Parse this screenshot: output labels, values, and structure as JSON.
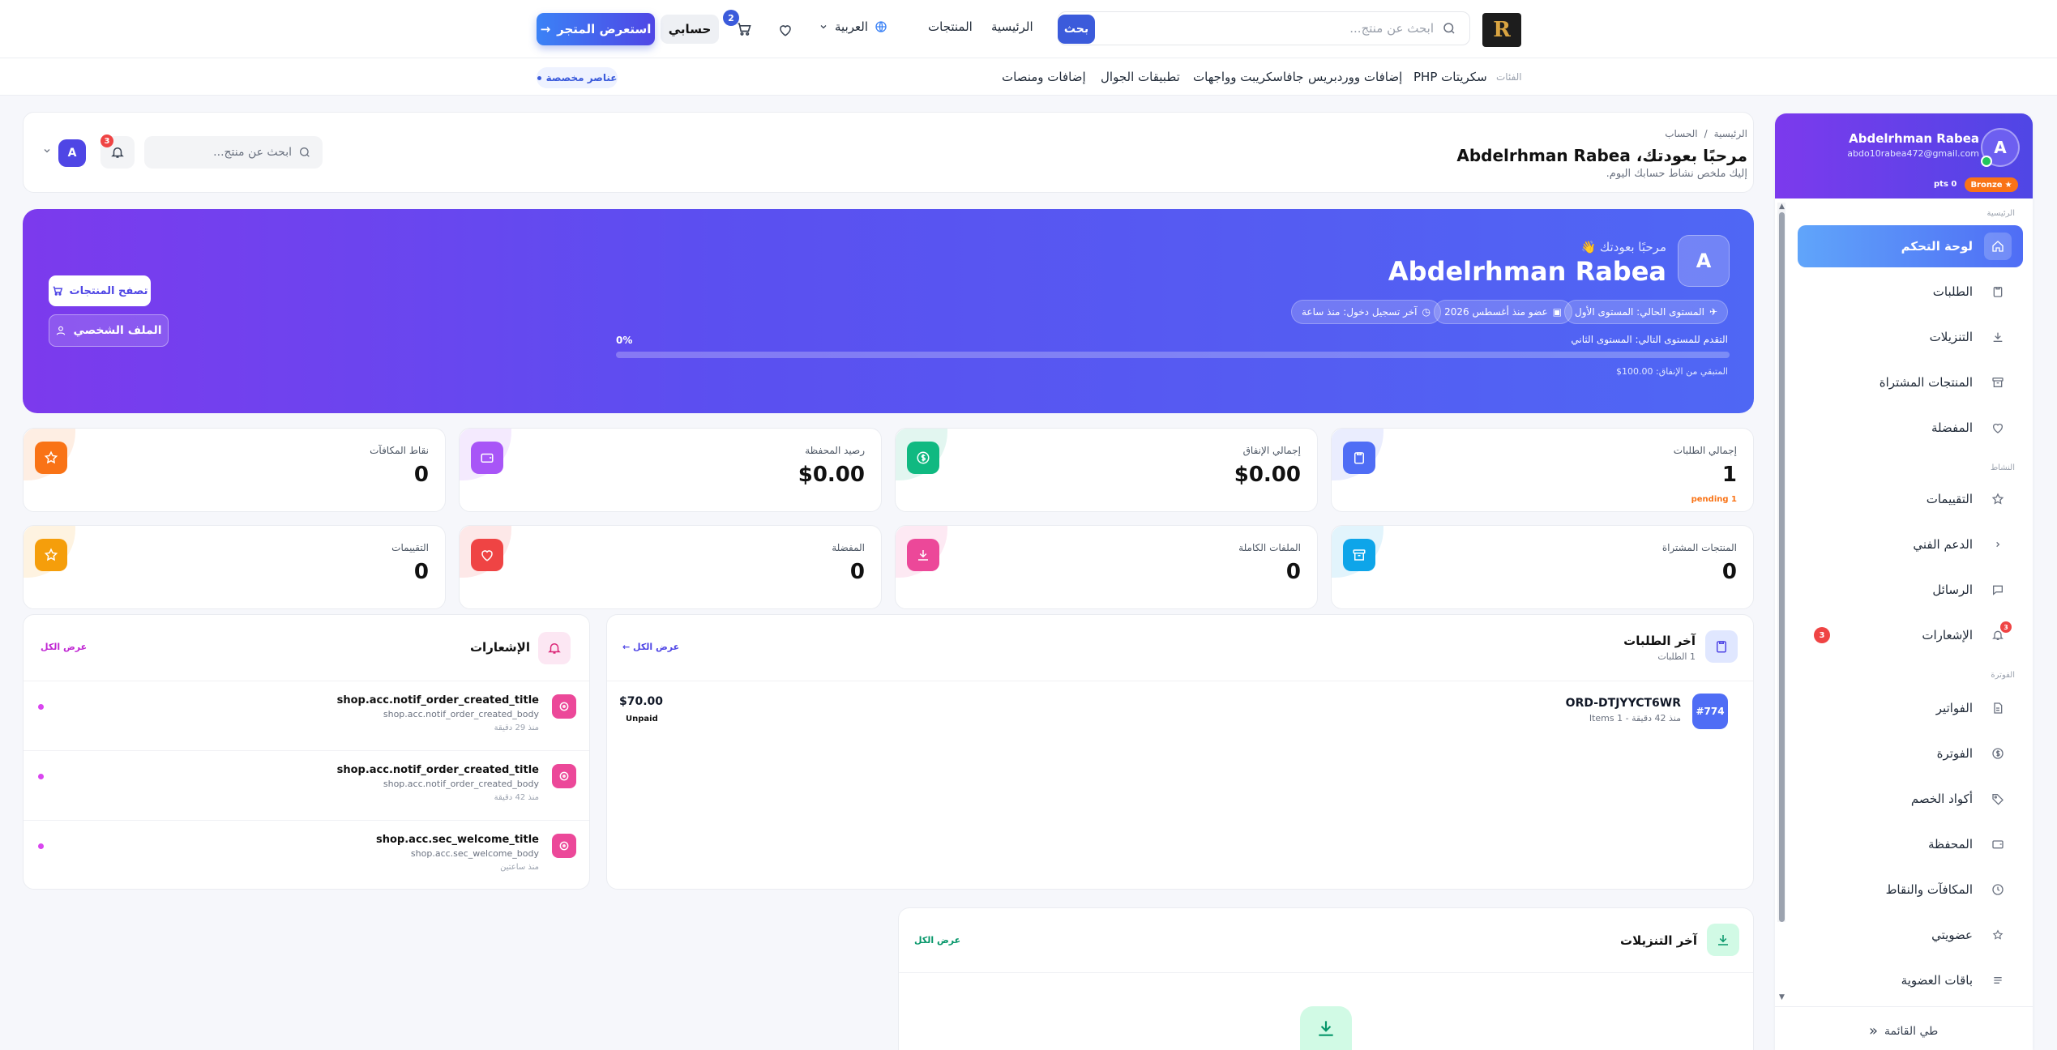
{
  "topbar": {
    "logo_text": "R",
    "search_placeholder": "ابحث عن منتج...",
    "search_button": "بحث",
    "nav_home": "الرئيسية",
    "nav_products": "المنتجات",
    "language": "العربية",
    "account_label": "حسابي",
    "cart_count": "2",
    "browse_store": "استعرض المتجر"
  },
  "subnav": {
    "categories_label": "الفئات",
    "items": [
      "سكريتات PHP",
      "إضافات ووردبريس",
      "جافاسكريبت وواجهات",
      "تطبيقات الجوال",
      "إضافات ومنصات"
    ],
    "custom_items": "عناصر مخصصة"
  },
  "sidebar": {
    "avatar_letter": "A",
    "name": "Abdelrhman Rabea",
    "email": "abdo10rabea472@gmail.com",
    "tier": "Bronze",
    "points": "pts 0",
    "section_main": "الرئيسية",
    "section_activity": "النشاط",
    "section_billing": "الفوترة",
    "items": [
      {
        "label": "لوحة التحكم"
      },
      {
        "label": "الطلبات"
      },
      {
        "label": "التنزيلات"
      },
      {
        "label": "المنتجات المشتراة"
      },
      {
        "label": "المفضلة"
      },
      {
        "label": "التقييمات"
      },
      {
        "label": "الدعم الفني"
      },
      {
        "label": "الرسائل"
      },
      {
        "label": "الإشعارات",
        "badge": "3"
      },
      {
        "label": "الفواتير"
      },
      {
        "label": "الفوترة"
      },
      {
        "label": "أكواد الخصم"
      },
      {
        "label": "المحفظة"
      },
      {
        "label": "المكافآت والنقاط"
      },
      {
        "label": "عضويتي"
      },
      {
        "label": "باقات العضوية"
      }
    ],
    "collapse": "طي القائمة"
  },
  "header": {
    "breadcrumb_home": "الرئيسية",
    "breadcrumb_current": "الحساب",
    "welcome": "مرحبًا بعودتك، Abdelrhman Rabea",
    "subtitle": "إليك ملخص نشاط حسابك اليوم.",
    "search_placeholder": "ابحث عن منتج...",
    "bell_count": "3",
    "avatar_letter": "A"
  },
  "hero": {
    "avatar_letter": "A",
    "greeting": "مرحبًا بعودتك 👋",
    "name": "Abdelrhman Rabea",
    "chip_level": "المستوى الحالي: المستوى الأول",
    "chip_member": "عضو منذ أغسطس 2026",
    "chip_login": "آخر تسجيل دخول: منذ ساعة",
    "progress_label": "التقدم للمستوى التالي: المستوى الثاني",
    "progress_text": "0%",
    "progress_value": 0,
    "remaining": "المتبقي من الإنفاق: 100.00$",
    "browse_btn": "تصفح المنتجات",
    "profile_btn": "الملف الشخصي"
  },
  "stats": [
    {
      "label": "إجمالي الطلبات",
      "value": "1",
      "sub": "1 pending",
      "color": "#4f6df5"
    },
    {
      "label": "إجمالي الإنفاق",
      "value": "$0.00",
      "color": "#10b981"
    },
    {
      "label": "رصيد المحفظة",
      "value": "$0.00",
      "color": "#a855f7"
    },
    {
      "label": "نقاط المكافآت",
      "value": "0",
      "color": "#f97316"
    },
    {
      "label": "المنتجات المشتراة",
      "value": "0",
      "color": "#0ea5e9"
    },
    {
      "label": "الملفات الكاملة",
      "value": "0",
      "color": "#ec4899"
    },
    {
      "label": "المفضلة",
      "value": "0",
      "color": "#ef4444"
    },
    {
      "label": "التقييمات",
      "value": "0",
      "color": "#f59e0b"
    }
  ],
  "orders": {
    "title": "آخر الطلبات",
    "count": "1 الطلبات",
    "view_all": "عرض الكل ←",
    "items": [
      {
        "badge": "#774",
        "id": "ORD-DTJYYCT6WR",
        "meta": "منذ 42 دقيقة - 1 Items",
        "amount": "$70.00",
        "status": "Unpaid"
      }
    ]
  },
  "notifications": {
    "title": "الإشعارات",
    "view_all": "عرض الكل",
    "items": [
      {
        "title": "shop.acc.notif_order_created_title",
        "body": "shop.acc.notif_order_created_body",
        "time": "منذ 29 دقيقة"
      },
      {
        "title": "shop.acc.notif_order_created_title",
        "body": "shop.acc.notif_order_created_body",
        "time": "منذ 42 دقيقة"
      },
      {
        "title": "shop.acc.sec_welcome_title",
        "body": "shop.acc.sec_welcome_body",
        "time": "منذ ساعتين"
      }
    ]
  },
  "downloads": {
    "title": "آخر التنزيلات",
    "view_all": "عرض الكل"
  }
}
